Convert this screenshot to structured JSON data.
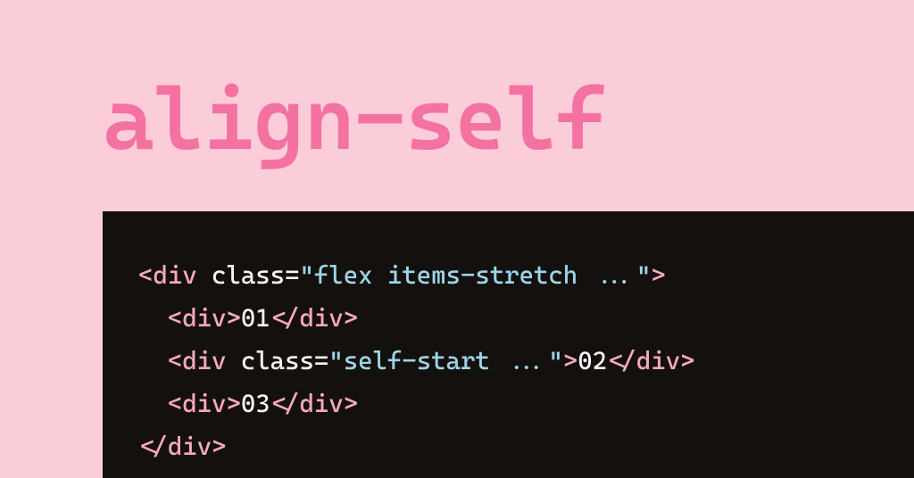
{
  "title": "align-self",
  "code": {
    "line1": {
      "tag": "div",
      "attr": "class",
      "value": "\"flex items-stretch ...\""
    },
    "line2": {
      "indent": "  ",
      "tag": "div",
      "text": "01"
    },
    "line3": {
      "indent": "  ",
      "tag": "div",
      "attr": "class",
      "value": "\"self-start ...\"",
      "text": "02"
    },
    "line4": {
      "indent": "  ",
      "tag": "div",
      "text": "03"
    },
    "line5": {
      "tag": "div"
    }
  }
}
